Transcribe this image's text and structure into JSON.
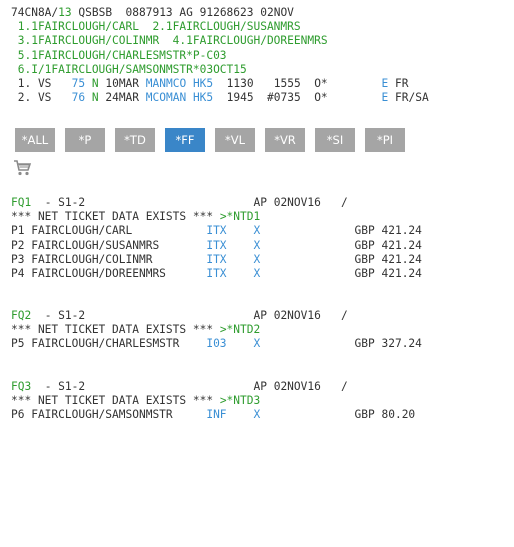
{
  "terminal": {
    "header": {
      "code": "74CN8A/",
      "num": "13",
      "rest": " QSBSB  0887913 AG 91268623 02NOV"
    },
    "names": [
      " 1.1FAIRCLOUGH/CARL  2.1FAIRCLOUGH/SUSANMRS",
      " 3.1FAIRCLOUGH/COLINMR  4.1FAIRCLOUGH/DOREENMRS",
      " 5.1FAIRCLOUGH/CHARLESMSTR*P-C03",
      " 6.I/1FAIRCLOUGH/SAMSONMSTR*03OCT15"
    ],
    "segments": [
      {
        "num": " 1. VS   ",
        "flight": "75",
        "cls": "N",
        "date": " 10MAR ",
        "route": "MANMCO",
        "status": "HK5",
        "times": "  1130   1555  O*        ",
        "e": "E",
        "end": " FR"
      },
      {
        "num": " 2. VS   ",
        "flight": "76",
        "cls": "N",
        "date": " 24MAR ",
        "route": "MCOMAN",
        "status": "HK5",
        "times": "  1945  #0735  O*        ",
        "e": "E",
        "end": " FR/SA"
      }
    ]
  },
  "toolbar": {
    "buttons": [
      {
        "label": "*ALL",
        "active": false
      },
      {
        "label": "*P",
        "active": false
      },
      {
        "label": "*TD",
        "active": false
      },
      {
        "label": "*FF",
        "active": true
      },
      {
        "label": "*VL",
        "active": false
      },
      {
        "label": "*VR",
        "active": false
      },
      {
        "label": "*SI",
        "active": false
      },
      {
        "label": "*PI",
        "active": false
      }
    ]
  },
  "fares": [
    {
      "id": "FQ1",
      "seg": "  - S1-2",
      "date": "AP 02NOV16   /",
      "net_text": "*** NET TICKET DATA EXISTS *** ",
      "net_cmd": ">*NTD1",
      "rows": [
        {
          "p": "P1 FAIRCLOUGH/CARL           ",
          "type": "ITX",
          "x": "X",
          "amount": "GBP 421.24"
        },
        {
          "p": "P2 FAIRCLOUGH/SUSANMRS       ",
          "type": "ITX",
          "x": "X",
          "amount": "GBP 421.24"
        },
        {
          "p": "P3 FAIRCLOUGH/COLINMR        ",
          "type": "ITX",
          "x": "X",
          "amount": "GBP 421.24"
        },
        {
          "p": "P4 FAIRCLOUGH/DOREENMRS      ",
          "type": "ITX",
          "x": "X",
          "amount": "GBP 421.24"
        }
      ]
    },
    {
      "id": "FQ2",
      "seg": "  - S1-2",
      "date": "AP 02NOV16   /",
      "net_text": "*** NET TICKET DATA EXISTS *** ",
      "net_cmd": ">*NTD2",
      "rows": [
        {
          "p": "P5 FAIRCLOUGH/CHARLESMSTR    ",
          "type": "I03",
          "x": "X",
          "amount": "GBP 327.24"
        }
      ]
    },
    {
      "id": "FQ3",
      "seg": "  - S1-2",
      "date": "AP 02NOV16   /",
      "net_text": "*** NET TICKET DATA EXISTS *** ",
      "net_cmd": ">*NTD3",
      "rows": [
        {
          "p": "P6 FAIRCLOUGH/SAMSONMSTR     ",
          "type": "INF",
          "x": "X",
          "amount": "GBP 80.20"
        }
      ]
    }
  ],
  "colors": {
    "green": "#2e9c2e",
    "blue": "#3a8fd4",
    "button": "#a5a5a5",
    "button_active": "#3a86c8"
  }
}
